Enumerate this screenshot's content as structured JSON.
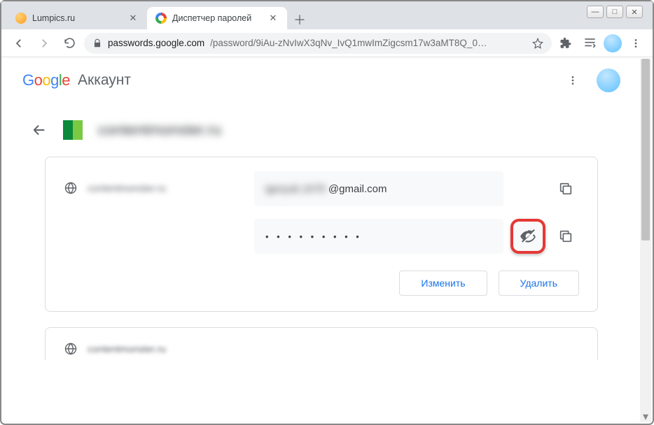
{
  "window_buttons": {
    "min": "—",
    "max": "□",
    "close": "✕"
  },
  "tabs": [
    {
      "title": "Lumpics.ru",
      "favicon": "orange"
    },
    {
      "title": "Диспетчер паролей",
      "favicon": "google"
    }
  ],
  "omnibox": {
    "domain": "passwords.google.com",
    "path": "/password/9iAu-zNvIwX3qNv_IvQ1mwImZigcsm17w3aMT8Q_0…"
  },
  "app_header": {
    "google": "Google",
    "account": "Аккаунт"
  },
  "page": {
    "site_title": "contentmonster.ru"
  },
  "card": {
    "site_label": "contentmonster.ru",
    "username_blur": "igoryuk.1070",
    "username_suffix": "@gmail.com",
    "password_masked": "• • • • • • • • •",
    "edit": "Изменить",
    "delete": "Удалить"
  },
  "card2": {
    "site_label": "contentmonster.ru"
  }
}
